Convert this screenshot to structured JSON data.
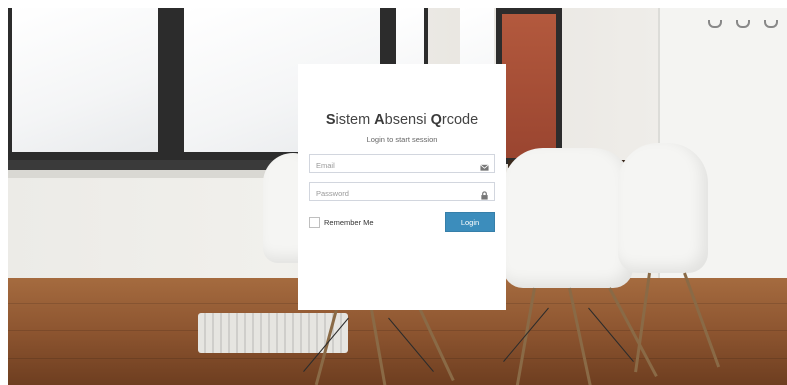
{
  "login": {
    "title_parts": [
      {
        "initial": "S",
        "rest": "istem "
      },
      {
        "initial": "A",
        "rest": "bsensi "
      },
      {
        "initial": "Q",
        "rest": "rcode"
      }
    ],
    "subtitle": "Login to start session",
    "email_placeholder": "Email",
    "password_placeholder": "Password",
    "remember_label": "Remember Me",
    "login_label": "Login",
    "email_icon": "envelope-icon",
    "password_icon": "lock-icon"
  },
  "colors": {
    "primary": "#3c8dbc",
    "card": "#ffffff",
    "input_border": "#d2d6de"
  }
}
